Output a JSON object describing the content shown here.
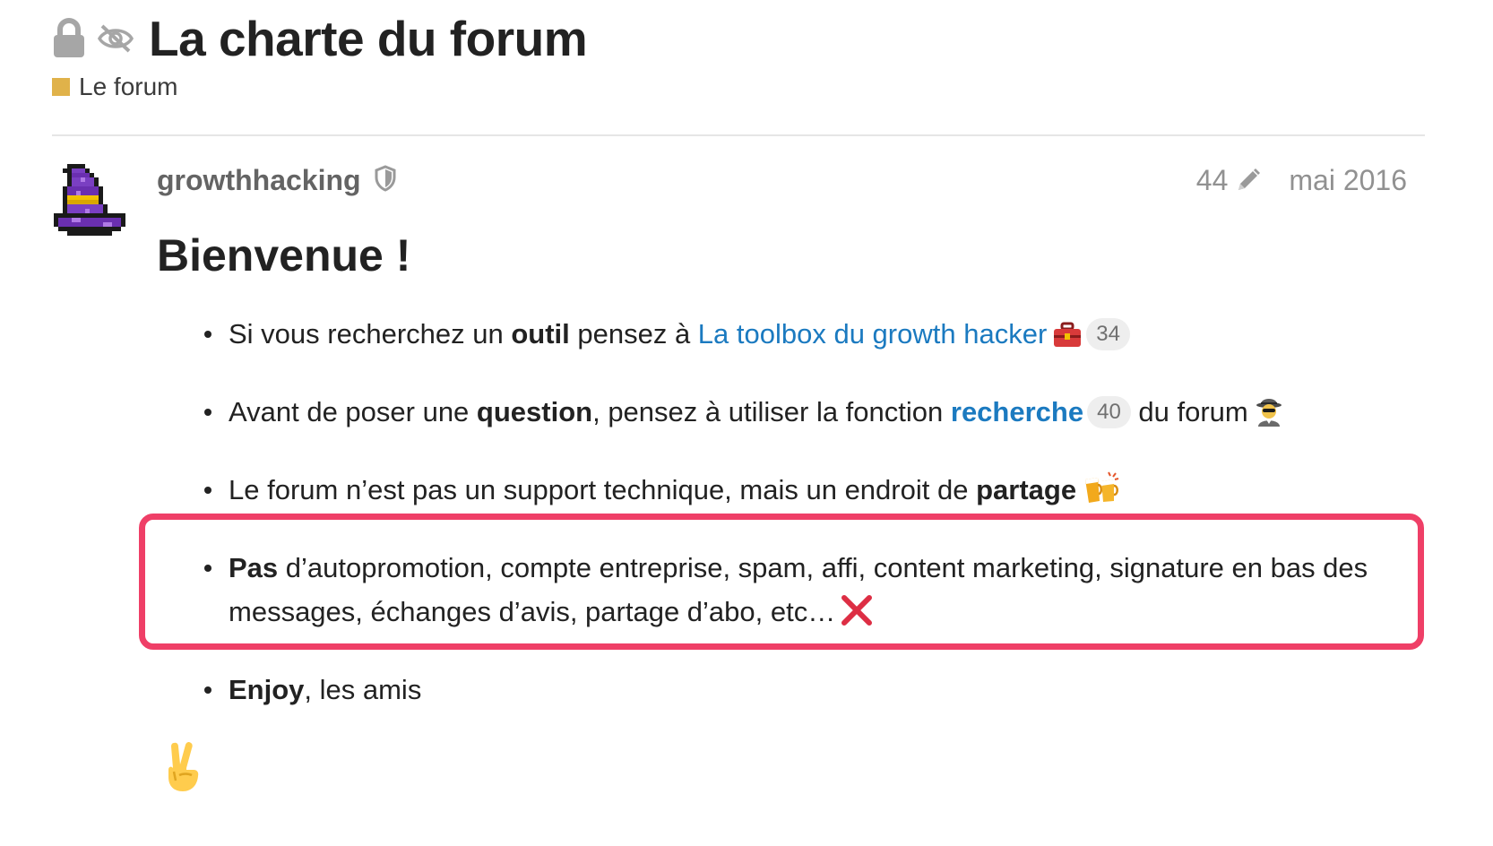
{
  "topic": {
    "title": "La charte du forum",
    "category": "Le forum",
    "category_color": "#e0b24a",
    "status_icons": [
      "lock-icon",
      "unlisted-eye-slash-icon"
    ]
  },
  "post": {
    "username": "growthhacking",
    "user_badge_icon": "shield-icon",
    "edit_count": "44",
    "edit_icon": "pencil-icon",
    "date": "mai 2016",
    "heading": "Bienvenue !",
    "items": [
      {
        "t1": "Si vous recherchez un ",
        "b1": "outil",
        "t2": " pensez à ",
        "link": "La toolbox du growth hacker",
        "emoji": "toolbox-emoji",
        "clicks": "34"
      },
      {
        "t1": "Avant de poser une ",
        "b1": "question",
        "t2": ", pensez à utiliser la fonction ",
        "link": "recherche",
        "clicks": "40",
        "t3": " du forum",
        "emoji": "detective-emoji"
      },
      {
        "t1": "Le forum n’est pas un support technique, mais un endroit de ",
        "b1": "partage",
        "emoji": "beers-emoji"
      },
      {
        "b1": "Pas",
        "t1": " d’autopromotion, compte entreprise, spam, affi, content marketing, signature en bas des messages, échanges d’avis, partage d’abo, etc…",
        "emoji": "cross-mark-emoji"
      },
      {
        "b1": "Enjoy",
        "t1": ", les amis"
      }
    ],
    "closing_emoji": "victory-hand-emoji"
  },
  "annotation": {
    "highlight_color": "#ef3f67"
  }
}
